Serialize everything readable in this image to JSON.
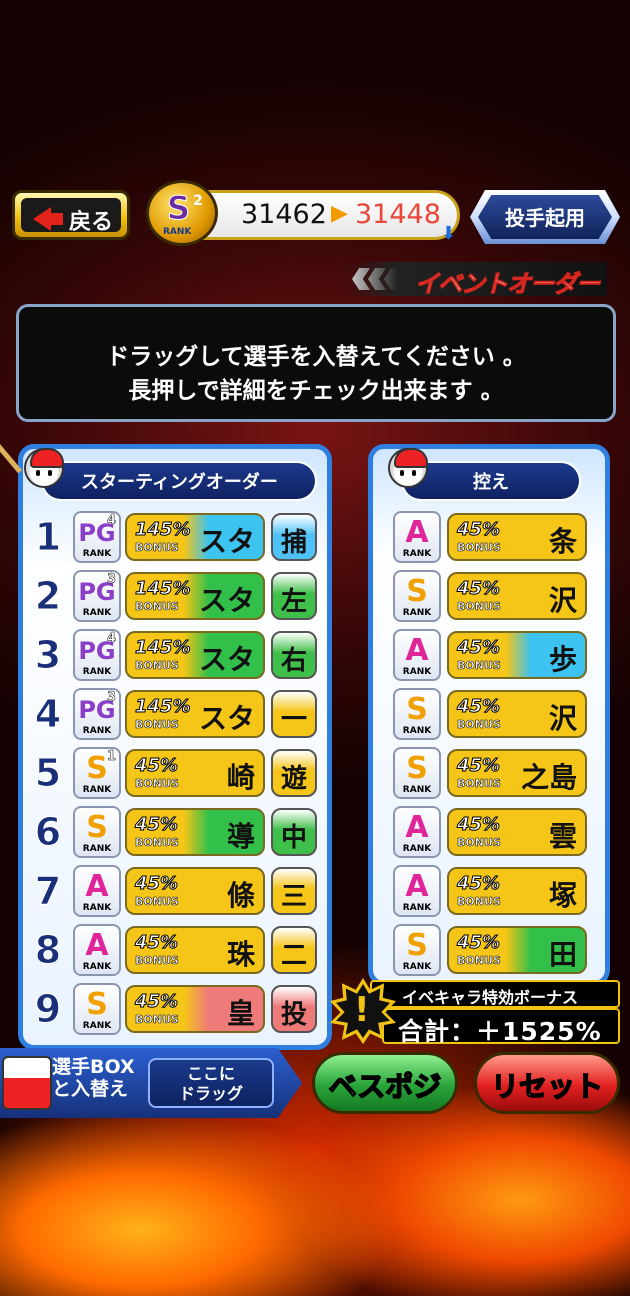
{
  "header": {
    "back_label": "戻る",
    "rank_letter": "S",
    "rank_sub": "2",
    "rank_word": "RANK",
    "score_current": "31462",
    "score_arrow": "▶",
    "score_next": "31448",
    "pitcher_button": "投手起用",
    "event_order_label": "イベントオーダー"
  },
  "message": {
    "line1": "ドラッグして選手を入替えてください 。",
    "line2": "長押しで詳細をチェック出来ます 。"
  },
  "starting": {
    "title": "スターティングオーダー",
    "rows": [
      {
        "num": "1",
        "rank": "PG",
        "rank_sub": "4",
        "rank_word": "RANK",
        "bonus": "145%",
        "bonus_label": "BONUS",
        "name": "スタ",
        "pos": "捕",
        "card_color": "#3cc3f0",
        "pos_color": "#4fc3f7"
      },
      {
        "num": "2",
        "rank": "PG",
        "rank_sub": "3",
        "rank_word": "RANK",
        "bonus": "145%",
        "bonus_label": "BONUS",
        "name": "スタ",
        "pos": "左",
        "card_color": "#33c04a",
        "pos_color": "#3fc04a"
      },
      {
        "num": "3",
        "rank": "PG",
        "rank_sub": "4",
        "rank_word": "RANK",
        "bonus": "145%",
        "bonus_label": "BONUS",
        "name": "スタ",
        "pos": "右",
        "card_color": "#33c04a",
        "pos_color": "#3fc04a"
      },
      {
        "num": "4",
        "rank": "PG",
        "rank_sub": "3",
        "rank_word": "RANK",
        "bonus": "145%",
        "bonus_label": "BONUS",
        "name": "スタ",
        "pos": "一",
        "card_color": "#f5c518",
        "pos_color": "#f5c518"
      },
      {
        "num": "5",
        "rank": "S",
        "rank_sub": "1",
        "rank_word": "RANK",
        "bonus": "45%",
        "bonus_label": "BONUS",
        "name": "崎",
        "pos": "遊",
        "card_color": "#f5c518",
        "pos_color": "#f5c518"
      },
      {
        "num": "6",
        "rank": "S",
        "rank_sub": "",
        "rank_word": "RANK",
        "bonus": "45%",
        "bonus_label": "BONUS",
        "name": "導",
        "pos": "中",
        "card_color": "#33c04a",
        "pos_color": "#3fc04a"
      },
      {
        "num": "7",
        "rank": "A",
        "rank_sub": "",
        "rank_word": "RANK",
        "bonus": "45%",
        "bonus_label": "BONUS",
        "name": "條",
        "pos": "三",
        "card_color": "#f5c518",
        "pos_color": "#f5c518"
      },
      {
        "num": "8",
        "rank": "A",
        "rank_sub": "",
        "rank_word": "RANK",
        "bonus": "45%",
        "bonus_label": "BONUS",
        "name": "珠",
        "pos": "二",
        "card_color": "#f5c518",
        "pos_color": "#f5c518"
      },
      {
        "num": "9",
        "rank": "S",
        "rank_sub": "",
        "rank_word": "RANK",
        "bonus": "45%",
        "bonus_label": "BONUS",
        "name": "皇",
        "pos": "投",
        "card_color": "#ef7a7a",
        "pos_color": "#ef7a7a"
      }
    ]
  },
  "bench": {
    "title": "控え",
    "rows": [
      {
        "rank": "A",
        "rank_word": "RANK",
        "bonus": "45%",
        "bonus_label": "BONUS",
        "name": "条",
        "card_color": "#f5c518"
      },
      {
        "rank": "S",
        "rank_word": "RANK",
        "bonus": "45%",
        "bonus_label": "BONUS",
        "name": "沢",
        "card_color": "#f5c518"
      },
      {
        "rank": "A",
        "rank_word": "RANK",
        "bonus": "45%",
        "bonus_label": "BONUS",
        "name": "歩",
        "card_color": "#3cc3f0"
      },
      {
        "rank": "S",
        "rank_word": "RANK",
        "bonus": "45%",
        "bonus_label": "BONUS",
        "name": "沢",
        "card_color": "#f5c518"
      },
      {
        "rank": "S",
        "rank_word": "RANK",
        "bonus": "45%",
        "bonus_label": "BONUS",
        "name": "之島",
        "card_color": "#f5c518"
      },
      {
        "rank": "A",
        "rank_word": "RANK",
        "bonus": "45%",
        "bonus_label": "BONUS",
        "name": "雲",
        "card_color": "#f5c518"
      },
      {
        "rank": "A",
        "rank_word": "RANK",
        "bonus": "45%",
        "bonus_label": "BONUS",
        "name": "塚",
        "card_color": "#f5c518"
      },
      {
        "rank": "S",
        "rank_word": "RANK",
        "bonus": "45%",
        "bonus_label": "BONUS",
        "name": "田",
        "card_color": "#33c04a"
      }
    ]
  },
  "event_bonus": {
    "label": "イベキャラ特効ボーナス",
    "total": "合計：＋1525%"
  },
  "footer": {
    "box_label_1": "選手BOX",
    "box_label_2": "と入替え",
    "drop_1": "ここに",
    "drop_2": "ドラッグ",
    "best_button": "ベスポジ",
    "reset_button": "リセット"
  },
  "colors": {
    "accent_gold": "#f2c313",
    "panel_blue": "#2e7fe0",
    "reset_red": "#e22020",
    "best_green": "#2aa43a"
  }
}
